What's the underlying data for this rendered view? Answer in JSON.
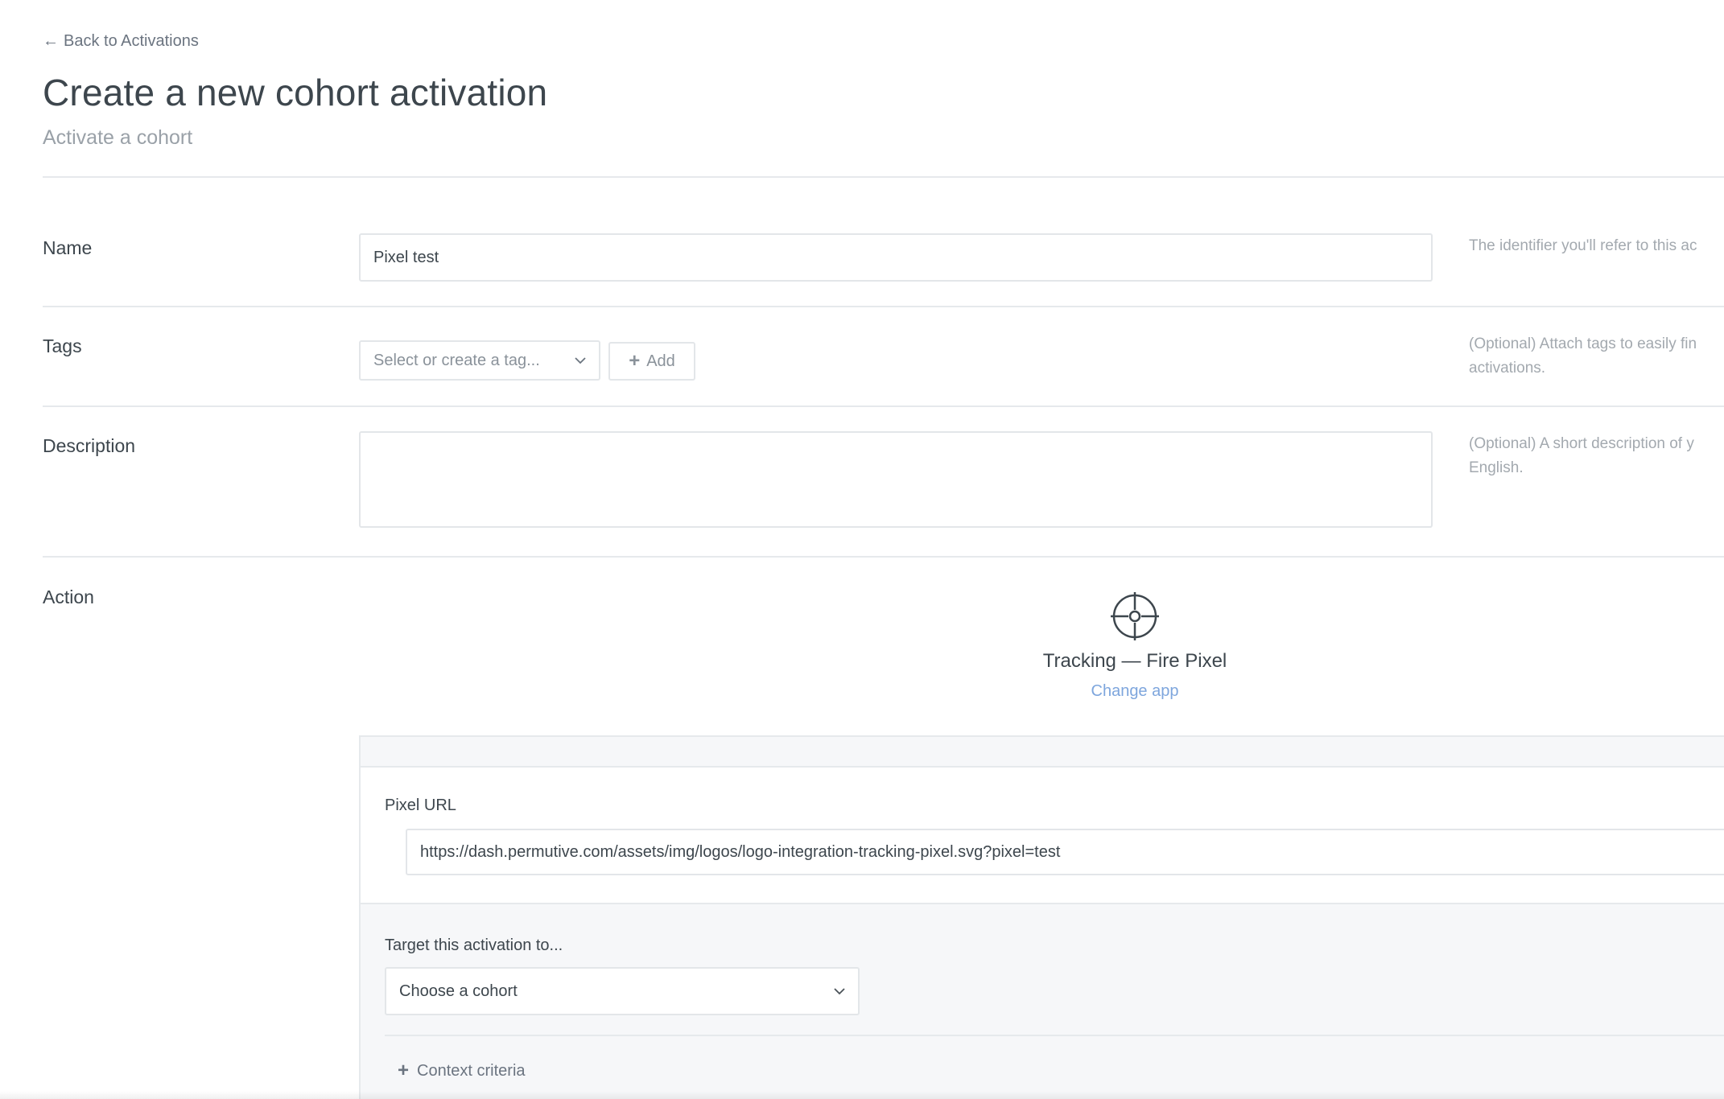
{
  "header": {
    "back_label": "Back to Activations",
    "title": "Create a new cohort activation",
    "subtitle": "Activate a cohort"
  },
  "form": {
    "name": {
      "label": "Name",
      "value": "Pixel test",
      "help": "The identifier you'll refer to this ac"
    },
    "tags": {
      "label": "Tags",
      "select_placeholder": "Select or create a tag...",
      "add_label": "Add",
      "help_line1": "(Optional) Attach tags to easily fin",
      "help_line2": "activations."
    },
    "description": {
      "label": "Description",
      "value": "",
      "help_line1": "(Optional) A short description of y",
      "help_line2": "English."
    },
    "action": {
      "label": "Action",
      "icon": "crosshair-icon",
      "app_name": "Tracking — Fire Pixel",
      "change_app_label": "Change app",
      "pixel_url_label": "Pixel URL",
      "pixel_url_value": "https://dash.permutive.com/assets/img/logos/logo-integration-tracking-pixel.svg?pixel=test",
      "target_label": "Target this activation to...",
      "cohort_placeholder": "Choose a cohort",
      "context_criteria_label": "Context criteria"
    }
  },
  "colors": {
    "link": "#7ea6dd",
    "text": "#3d464d",
    "muted": "#a3a9af",
    "border": "#e3e6e9",
    "panel_bg": "#f6f7f9"
  }
}
